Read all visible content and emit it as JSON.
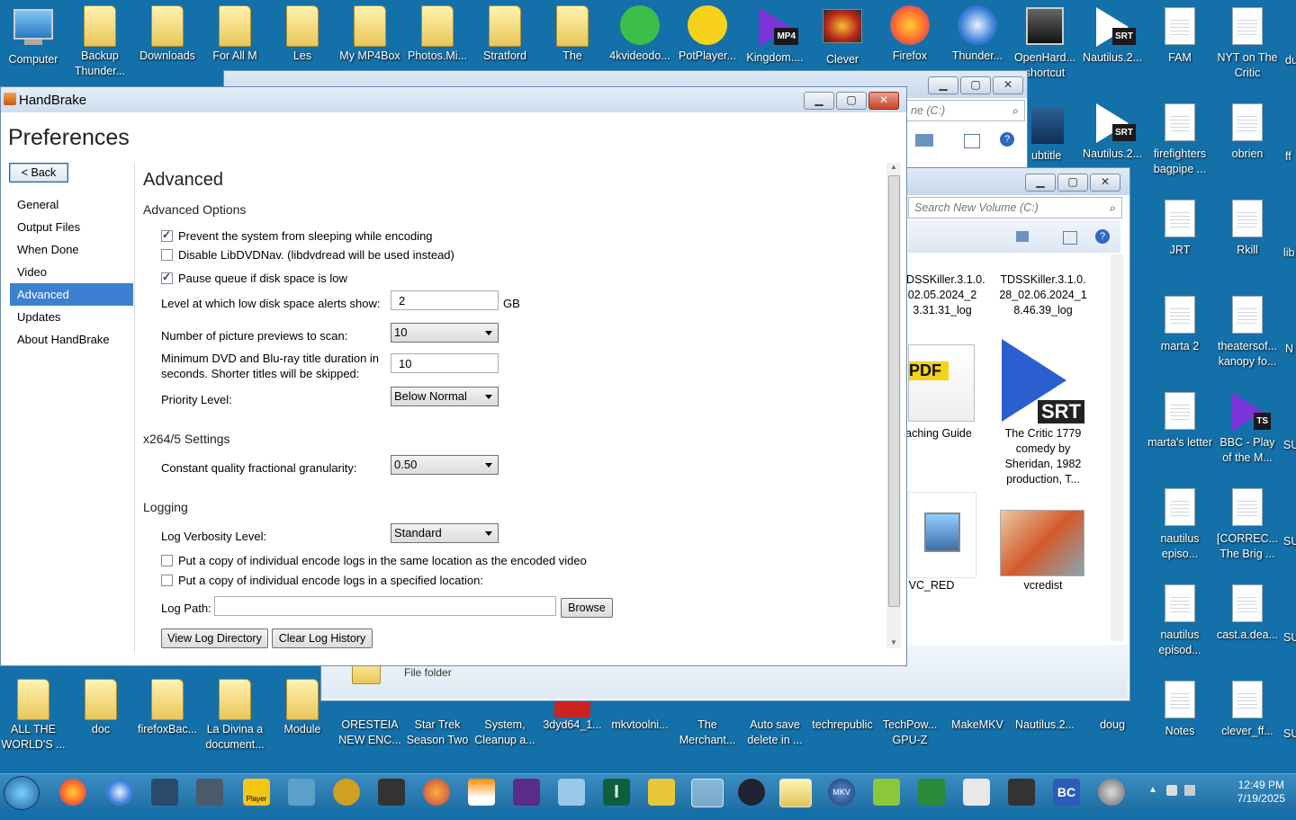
{
  "desktop": {
    "top_icons": [
      {
        "label": "Computer",
        "type": "monitor"
      },
      {
        "label": "Backup Thunder...",
        "type": "folder"
      },
      {
        "label": "Downloads",
        "type": "folder"
      },
      {
        "label": "For All M",
        "type": "folder"
      },
      {
        "label": "Les",
        "type": "folder"
      },
      {
        "label": "My MP4Box",
        "type": "folder"
      },
      {
        "label": "Photos.Mi...",
        "type": "folder"
      },
      {
        "label": "Stratford",
        "type": "folder"
      },
      {
        "label": "The",
        "type": "folder"
      },
      {
        "label": "4kvideodo...",
        "type": "app"
      },
      {
        "label": "PotPlayer...",
        "type": "app"
      },
      {
        "label": "Kingdom....",
        "type": "mp4"
      },
      {
        "label": "Clever",
        "type": "app"
      },
      {
        "label": "Firefox",
        "type": "app"
      },
      {
        "label": "Thunder...",
        "type": "app"
      },
      {
        "label": "OpenHard... shortcut",
        "type": "app"
      },
      {
        "label": "Nautilus.2...",
        "type": "srt"
      }
    ],
    "right_icons": [
      {
        "label": "FAM",
        "type": "doc"
      },
      {
        "label": "NYT on The Critic",
        "type": "doc"
      },
      {
        "label": "Nautilus.2...",
        "type": "srt"
      },
      {
        "label": "firefighters bagpipe ...",
        "type": "doc"
      },
      {
        "label": "obrien",
        "type": "doc"
      },
      {
        "label": "JRT",
        "type": "doc"
      },
      {
        "label": "Rkill",
        "type": "doc"
      },
      {
        "label": "marta 2",
        "type": "doc"
      },
      {
        "label": "theatersof... kanopy fo...",
        "type": "doc"
      },
      {
        "label": "marta's letter",
        "type": "doc"
      },
      {
        "label": "BBC - Play of the M...",
        "type": "ts"
      },
      {
        "label": "nautilus episo...",
        "type": "doc"
      },
      {
        "label": "[CORREC... The Brig ...",
        "type": "doc"
      },
      {
        "label": "nautilus episod...",
        "type": "doc"
      },
      {
        "label": "cast.a.dea...",
        "type": "doc"
      },
      {
        "label": "Notes",
        "type": "doc"
      },
      {
        "label": "clever_ff...",
        "type": "doc"
      }
    ],
    "bottom_icons": [
      {
        "label": "ALL THE WORLD'S ..."
      },
      {
        "label": "doc"
      },
      {
        "label": "firefoxBac..."
      },
      {
        "label": "La Divina a document..."
      },
      {
        "label": "Module"
      },
      {
        "label": "ORESTEIA NEW ENC..."
      },
      {
        "label": "Star Trek Season Two"
      },
      {
        "label": "System, Cleanup a..."
      },
      {
        "label": "3dyd64_1..."
      },
      {
        "label": "mkvtoolni..."
      },
      {
        "label": "The Merchant..."
      },
      {
        "label": "Auto save delete in ..."
      },
      {
        "label": "techrepublic"
      },
      {
        "label": "TechPow... GPU-Z"
      },
      {
        "label": "MakeMKV"
      },
      {
        "label": "Nautilus.2..."
      },
      {
        "label": "doug"
      },
      {
        "label": "Notes"
      },
      {
        "label": "clever_ff..."
      }
    ],
    "edge_labels": [
      "du",
      "ff",
      "lib",
      "N",
      "SU",
      "SU",
      "SU",
      "SU"
    ]
  },
  "explorer_back": {
    "search_placeholder": "Search New Volume (C:)",
    "search_partial": "ne (C:)",
    "files": [
      {
        "label": "TDSSKiller.3.1.0. 02.05.2024_2 3.31.31_log"
      },
      {
        "label": "TDSSKiller.3.1.0. 28_02.06.2024_1 8.46.39_log"
      },
      {
        "label": "aching Guide"
      },
      {
        "label": "The Critic 1779 comedy by Sheridan, 1982 production, T..."
      },
      {
        "label": "VC_RED"
      },
      {
        "label": "vcredist"
      }
    ],
    "status": "File folder",
    "subtitle_partial": "ubtitle"
  },
  "handbrake": {
    "window_title": "HandBrake",
    "page_title": "Preferences",
    "back_label": "< Back",
    "nav": [
      "General",
      "Output Files",
      "When Done",
      "Video",
      "Advanced",
      "Updates",
      "About HandBrake"
    ],
    "selected_nav": "Advanced",
    "section_title": "Advanced",
    "advanced_options_label": "Advanced Options",
    "opt_prevent_sleep": "Prevent the system from sleeping while encoding",
    "opt_prevent_sleep_checked": true,
    "opt_disable_libdvdnav": "Disable LibDVDNav. (libdvdread will be used instead)",
    "opt_disable_libdvdnav_checked": false,
    "opt_pause_queue": "Pause queue if disk space is low",
    "opt_pause_queue_checked": true,
    "low_disk_label": "Level at which low disk space alerts show:",
    "low_disk_value": "2",
    "low_disk_unit": "GB",
    "previews_label": "Number of picture previews to scan:",
    "previews_value": "10",
    "min_duration_label": "Minimum DVD and Blu-ray title duration in seconds. Shorter titles will be skipped:",
    "min_duration_value": "10",
    "priority_label": "Priority Level:",
    "priority_value": "Below Normal",
    "x264_title": "x264/5 Settings",
    "granularity_label": "Constant quality fractional granularity:",
    "granularity_value": "0.50",
    "logging_title": "Logging",
    "verbosity_label": "Log Verbosity Level:",
    "verbosity_value": "Standard",
    "log_copy_same": "Put a copy of individual encode logs in the same location as the encoded video",
    "log_copy_same_checked": false,
    "log_copy_specified": "Put a copy of individual encode logs in a specified location:",
    "log_copy_specified_checked": false,
    "log_path_label": "Log Path:",
    "log_path_value": "",
    "browse_label": "Browse",
    "view_log_label": "View Log Directory",
    "clear_log_label": "Clear Log History"
  },
  "taskbar": {
    "time": "12:49 PM",
    "date": "7/19/2025",
    "mkv_label": "MKV",
    "bc_label": "BC",
    "player_label": "Player"
  }
}
